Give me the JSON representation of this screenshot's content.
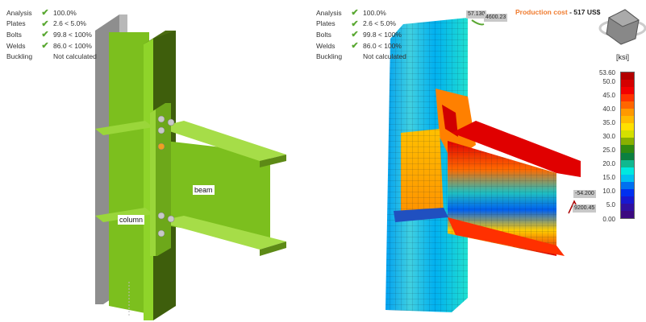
{
  "checks": [
    {
      "label": "Analysis",
      "status": "ok",
      "value": "100.0%"
    },
    {
      "label": "Plates",
      "status": "ok",
      "value": "2.6 < 5.0%"
    },
    {
      "label": "Bolts",
      "status": "ok",
      "value": "99.8 < 100%"
    },
    {
      "label": "Welds",
      "status": "ok",
      "value": "86.0 < 100%"
    },
    {
      "label": "Buckling",
      "status": "none",
      "value": "Not calculated"
    }
  ],
  "left_view": {
    "labels": {
      "beam": "beam",
      "column": "column"
    }
  },
  "right_view": {
    "production_cost_label": "Production cost",
    "separator": "-",
    "production_cost_value": "517 US$",
    "tags": {
      "t1": "57.130",
      "t2": "4600.23",
      "t3": "-54.200",
      "t4": "9200.45"
    }
  },
  "legend": {
    "unit": "[ksi]",
    "ticks": [
      "53.60",
      "50.0",
      "45.0",
      "40.0",
      "35.0",
      "30.0",
      "25.0",
      "20.0",
      "15.0",
      "10.0",
      "5.0",
      "0.00"
    ],
    "colors": [
      "#b30000",
      "#d40000",
      "#f20000",
      "#ff3300",
      "#ff6600",
      "#ff9900",
      "#ffbb00",
      "#ffe000",
      "#d4e000",
      "#88b000",
      "#2f8a10",
      "#0a8040",
      "#10b890",
      "#00e8e0",
      "#00c0f0",
      "#0070f0",
      "#0030f0",
      "#1818d0",
      "#3010a0",
      "#3c0a80"
    ]
  },
  "check_icon": "checkmark-icon",
  "navigation_cube_icon": "view-cube-icon"
}
